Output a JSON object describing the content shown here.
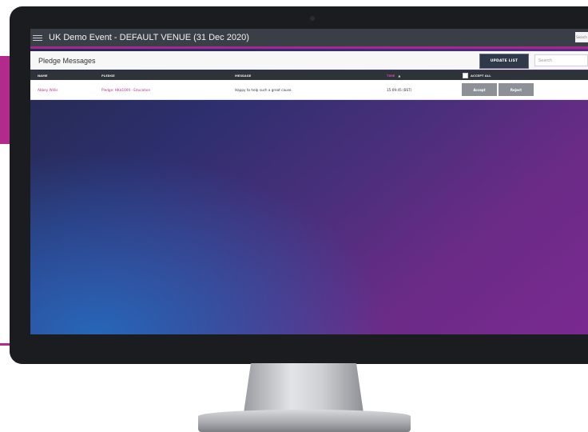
{
  "app": {
    "title": "UK Demo Event - DEFAULT VENUE (31 Dec 2020)",
    "search_mini": "Search"
  },
  "panel": {
    "title": "Pledge Messages",
    "update_label": "UPDATE LIST",
    "search_placeholder": "Search"
  },
  "table": {
    "columns": {
      "name": "NAME",
      "pledge": "PLEDGE",
      "message": "MESSAGE",
      "time": "TIME",
      "time_sort": "▲",
      "accept_all": "ACCEPT ALL"
    },
    "rows": [
      {
        "name": "Abbey Willis",
        "pledge": "Pledge: HK$1000 - Education",
        "message": "Happy to help such a great cause.",
        "time": "15:09:45 (BST)",
        "accept_label": "Accept",
        "reject_label": "Reject"
      }
    ]
  },
  "colors": {
    "accent": "#a6278e",
    "header_bar": "#3a3e46",
    "table_header": "#2e3239",
    "link": "#b1338f"
  },
  "icons": {
    "menu": "hamburger-icon",
    "checkbox": "checkbox-icon"
  }
}
